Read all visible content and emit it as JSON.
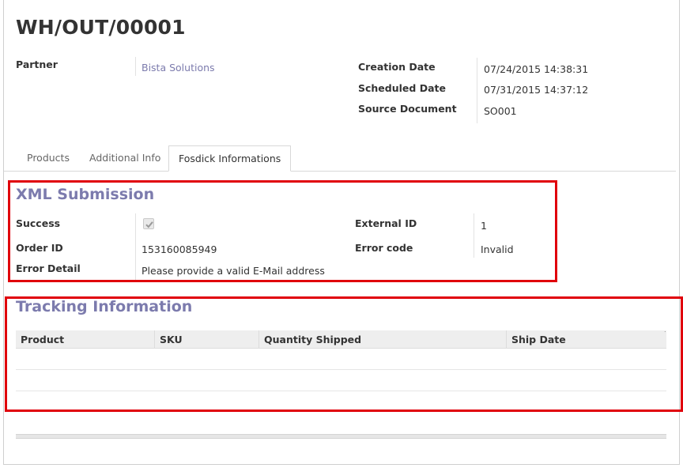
{
  "record": {
    "title": "WH/OUT/00001"
  },
  "header_fields": {
    "partner_label": "Partner",
    "partner_value": "Bista Solutions",
    "creation_date_label": "Creation Date",
    "creation_date_value": "07/24/2015 14:38:31",
    "scheduled_date_label": "Scheduled Date",
    "scheduled_date_value": "07/31/2015 14:37:12",
    "source_document_label": "Source Document",
    "source_document_value": "SO001"
  },
  "tabs": [
    {
      "label": "Products",
      "active": false
    },
    {
      "label": "Additional Info",
      "active": false
    },
    {
      "label": "Fosdick Informations",
      "active": true
    }
  ],
  "xml_submission": {
    "title": "XML Submission",
    "success_label": "Success",
    "success_checked": true,
    "external_id_label": "External ID",
    "external_id_value": "1",
    "order_id_label": "Order ID",
    "order_id_value": "153160085949",
    "error_code_label": "Error code",
    "error_code_value": "Invalid",
    "error_detail_label": "Error Detail",
    "error_detail_value": "Please provide a valid E-Mail address"
  },
  "tracking": {
    "title": "Tracking Information",
    "columns": [
      "Product",
      "SKU",
      "Quantity Shipped",
      "Ship Date"
    ],
    "rows": []
  },
  "colors": {
    "accent": "#7c7bad",
    "highlight_box": "#e0000b",
    "header_bg": "#eeeeee"
  }
}
